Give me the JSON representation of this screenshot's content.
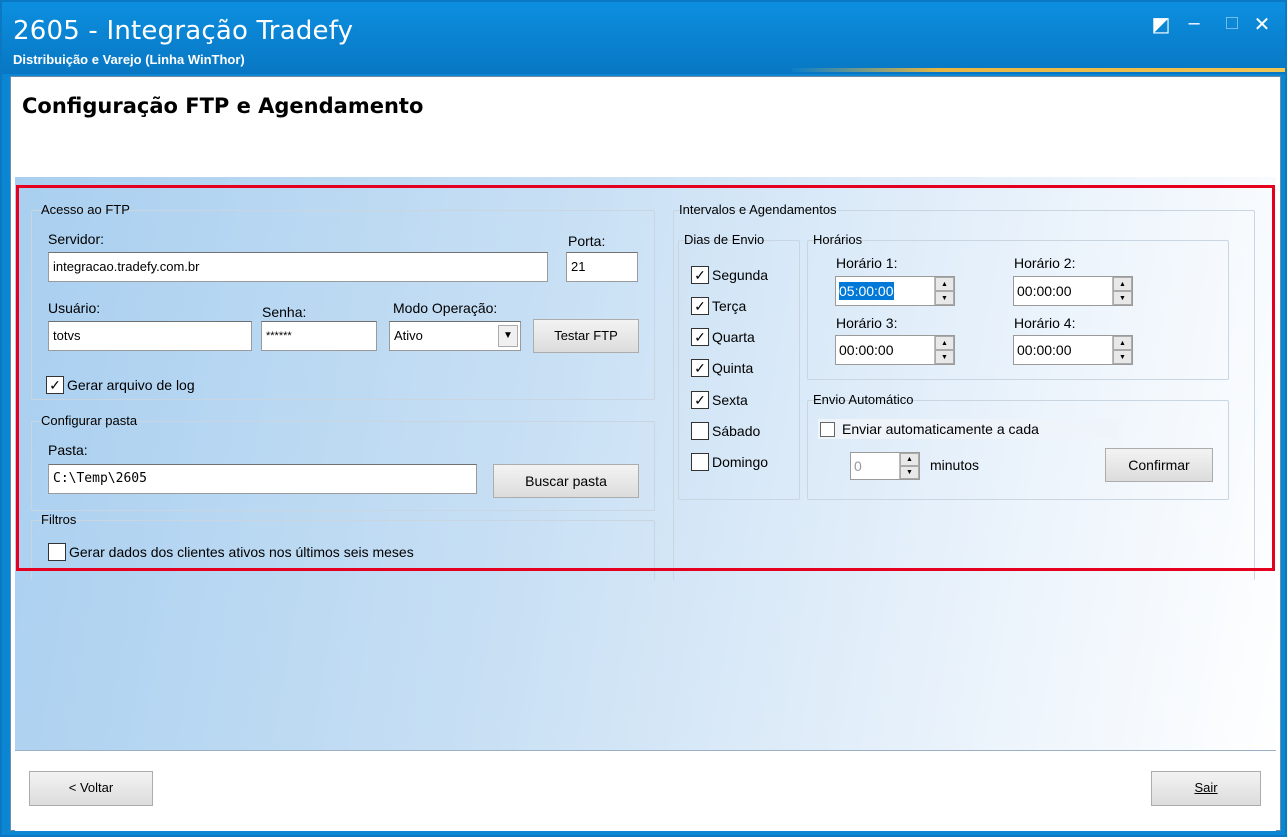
{
  "window": {
    "title": "2605 - Integração Tradefy",
    "subtitle": "Distribuição e Varejo (Linha WinThor)",
    "controls": {
      "restore": "◩",
      "minimize": "–",
      "maximize": "□",
      "close": "✕"
    }
  },
  "page_title": "Configuração FTP e Agendamento",
  "ftp": {
    "legend": "Acesso ao FTP",
    "server_label": "Servidor:",
    "server_value": "integracao.tradefy.com.br",
    "port_label": "Porta:",
    "port_value": "21",
    "user_label": "Usuário:",
    "user_value": "totvs",
    "password_label": "Senha:",
    "password_value": "******",
    "mode_label": "Modo Operação:",
    "mode_value": "Ativo",
    "test_button": "Testar FTP",
    "log_checkbox": {
      "label": "Gerar arquivo de log",
      "checked": true
    }
  },
  "folder": {
    "legend": "Configurar pasta",
    "folder_label": "Pasta:",
    "folder_value": "C:\\Temp\\2605",
    "browse_button": "Buscar pasta"
  },
  "filters": {
    "legend": "Filtros",
    "active_clients": {
      "label": "Gerar dados dos clientes ativos nos últimos seis meses",
      "checked": false
    }
  },
  "schedule": {
    "legend": "Intervalos e Agendamentos",
    "days_legend": "Dias de Envio",
    "days": [
      {
        "label": "Segunda",
        "checked": true
      },
      {
        "label": "Terça",
        "checked": true
      },
      {
        "label": "Quarta",
        "checked": true
      },
      {
        "label": "Quinta",
        "checked": true
      },
      {
        "label": "Sexta",
        "checked": true
      },
      {
        "label": "Sábado",
        "checked": false
      },
      {
        "label": "Domingo",
        "checked": false
      }
    ],
    "times_legend": "Horários",
    "times": [
      {
        "label": "Horário 1:",
        "value": "05:00:00"
      },
      {
        "label": "Horário 2:",
        "value": "00:00:00"
      },
      {
        "label": "Horário 3:",
        "value": "00:00:00"
      },
      {
        "label": "Horário 4:",
        "value": "00:00:00"
      }
    ],
    "auto_legend": "Envio Automático",
    "auto_checkbox": {
      "label": "Enviar automaticamente a cada",
      "checked": false
    },
    "auto_minutes_value": "0",
    "auto_minutes_unit": "minutos",
    "confirm_button": "Confirmar"
  },
  "footer": {
    "back_button": "< Voltar",
    "exit_button": "Sair"
  },
  "colors": {
    "titlebar": "#0a86d3",
    "highlight": "#e6001f",
    "selection": "#0078d7"
  }
}
